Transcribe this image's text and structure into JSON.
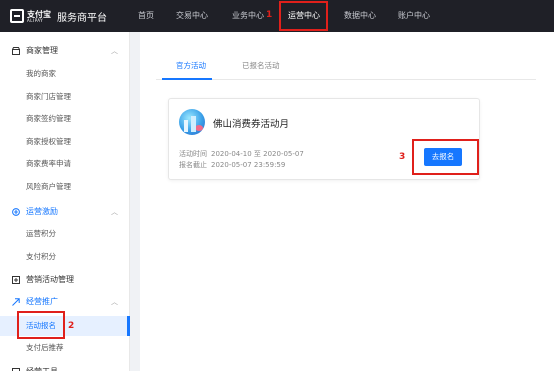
{
  "brand": {
    "name": "支付宝",
    "name_en": "ALIPAY",
    "platform": "服务商平台"
  },
  "top_nav": [
    {
      "label": "首页"
    },
    {
      "label": "交易中心"
    },
    {
      "label": "业务中心"
    },
    {
      "label": "运营中心"
    },
    {
      "label": "数据中心"
    },
    {
      "label": "账户中心"
    }
  ],
  "callouts": {
    "one": "1",
    "two": "2",
    "three": "3"
  },
  "sidebar": {
    "groups": [
      {
        "label": "商家管理",
        "icon": "store-icon",
        "items": [
          "我的商家",
          "商家门店管理",
          "商家签约管理",
          "商家授权管理",
          "商家费率申请",
          "风险商户管理"
        ]
      },
      {
        "label": "运营激励",
        "icon": "incentive-icon",
        "items": [
          "运营积分",
          "支付积分"
        ]
      },
      {
        "label": "营销活动管理",
        "icon": "campaign-icon",
        "items": []
      },
      {
        "label": "经营推广",
        "icon": "promotion-icon",
        "items": [
          "活动报名",
          "支付后推荐"
        ]
      },
      {
        "label": "经营工具",
        "icon": "tools-icon",
        "items": []
      }
    ]
  },
  "tabs": [
    {
      "label": "官方活动"
    },
    {
      "label": "已报名活动"
    }
  ],
  "activity": {
    "title": "佛山消费券活动月",
    "time_label": "活动时间",
    "time_value": "2020-04-10 至 2020-05-07",
    "deadline_label": "报名截止",
    "deadline_value": "2020-05-07 23:59:59",
    "signup_label": "去报名"
  },
  "colors": {
    "accent": "#1677ff",
    "topbar": "#1f2027",
    "callout": "#e0201b"
  }
}
